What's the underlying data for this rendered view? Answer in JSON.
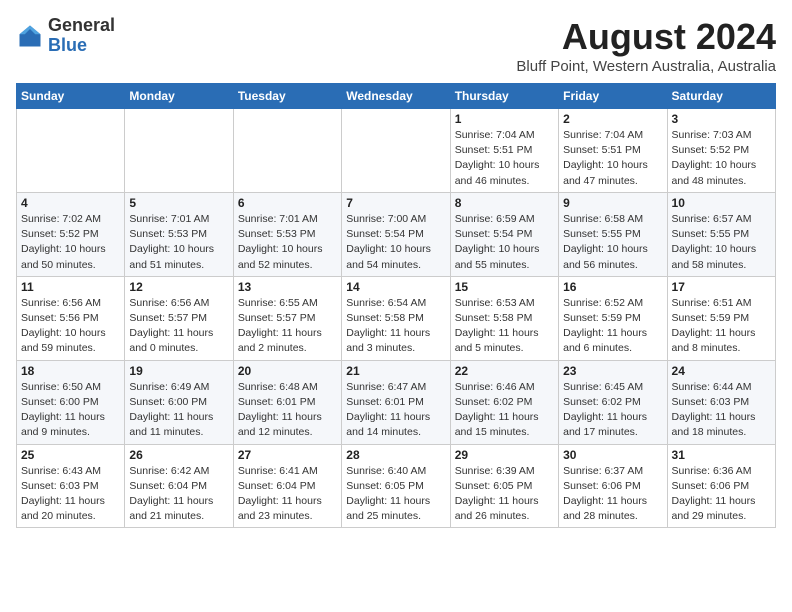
{
  "header": {
    "logo_general": "General",
    "logo_blue": "Blue",
    "month_title": "August 2024",
    "location": "Bluff Point, Western Australia, Australia"
  },
  "days_of_week": [
    "Sunday",
    "Monday",
    "Tuesday",
    "Wednesday",
    "Thursday",
    "Friday",
    "Saturday"
  ],
  "weeks": [
    [
      {
        "day": "",
        "detail": ""
      },
      {
        "day": "",
        "detail": ""
      },
      {
        "day": "",
        "detail": ""
      },
      {
        "day": "",
        "detail": ""
      },
      {
        "day": "1",
        "detail": "Sunrise: 7:04 AM\nSunset: 5:51 PM\nDaylight: 10 hours\nand 46 minutes."
      },
      {
        "day": "2",
        "detail": "Sunrise: 7:04 AM\nSunset: 5:51 PM\nDaylight: 10 hours\nand 47 minutes."
      },
      {
        "day": "3",
        "detail": "Sunrise: 7:03 AM\nSunset: 5:52 PM\nDaylight: 10 hours\nand 48 minutes."
      }
    ],
    [
      {
        "day": "4",
        "detail": "Sunrise: 7:02 AM\nSunset: 5:52 PM\nDaylight: 10 hours\nand 50 minutes."
      },
      {
        "day": "5",
        "detail": "Sunrise: 7:01 AM\nSunset: 5:53 PM\nDaylight: 10 hours\nand 51 minutes."
      },
      {
        "day": "6",
        "detail": "Sunrise: 7:01 AM\nSunset: 5:53 PM\nDaylight: 10 hours\nand 52 minutes."
      },
      {
        "day": "7",
        "detail": "Sunrise: 7:00 AM\nSunset: 5:54 PM\nDaylight: 10 hours\nand 54 minutes."
      },
      {
        "day": "8",
        "detail": "Sunrise: 6:59 AM\nSunset: 5:54 PM\nDaylight: 10 hours\nand 55 minutes."
      },
      {
        "day": "9",
        "detail": "Sunrise: 6:58 AM\nSunset: 5:55 PM\nDaylight: 10 hours\nand 56 minutes."
      },
      {
        "day": "10",
        "detail": "Sunrise: 6:57 AM\nSunset: 5:55 PM\nDaylight: 10 hours\nand 58 minutes."
      }
    ],
    [
      {
        "day": "11",
        "detail": "Sunrise: 6:56 AM\nSunset: 5:56 PM\nDaylight: 10 hours\nand 59 minutes."
      },
      {
        "day": "12",
        "detail": "Sunrise: 6:56 AM\nSunset: 5:57 PM\nDaylight: 11 hours\nand 0 minutes."
      },
      {
        "day": "13",
        "detail": "Sunrise: 6:55 AM\nSunset: 5:57 PM\nDaylight: 11 hours\nand 2 minutes."
      },
      {
        "day": "14",
        "detail": "Sunrise: 6:54 AM\nSunset: 5:58 PM\nDaylight: 11 hours\nand 3 minutes."
      },
      {
        "day": "15",
        "detail": "Sunrise: 6:53 AM\nSunset: 5:58 PM\nDaylight: 11 hours\nand 5 minutes."
      },
      {
        "day": "16",
        "detail": "Sunrise: 6:52 AM\nSunset: 5:59 PM\nDaylight: 11 hours\nand 6 minutes."
      },
      {
        "day": "17",
        "detail": "Sunrise: 6:51 AM\nSunset: 5:59 PM\nDaylight: 11 hours\nand 8 minutes."
      }
    ],
    [
      {
        "day": "18",
        "detail": "Sunrise: 6:50 AM\nSunset: 6:00 PM\nDaylight: 11 hours\nand 9 minutes."
      },
      {
        "day": "19",
        "detail": "Sunrise: 6:49 AM\nSunset: 6:00 PM\nDaylight: 11 hours\nand 11 minutes."
      },
      {
        "day": "20",
        "detail": "Sunrise: 6:48 AM\nSunset: 6:01 PM\nDaylight: 11 hours\nand 12 minutes."
      },
      {
        "day": "21",
        "detail": "Sunrise: 6:47 AM\nSunset: 6:01 PM\nDaylight: 11 hours\nand 14 minutes."
      },
      {
        "day": "22",
        "detail": "Sunrise: 6:46 AM\nSunset: 6:02 PM\nDaylight: 11 hours\nand 15 minutes."
      },
      {
        "day": "23",
        "detail": "Sunrise: 6:45 AM\nSunset: 6:02 PM\nDaylight: 11 hours\nand 17 minutes."
      },
      {
        "day": "24",
        "detail": "Sunrise: 6:44 AM\nSunset: 6:03 PM\nDaylight: 11 hours\nand 18 minutes."
      }
    ],
    [
      {
        "day": "25",
        "detail": "Sunrise: 6:43 AM\nSunset: 6:03 PM\nDaylight: 11 hours\nand 20 minutes."
      },
      {
        "day": "26",
        "detail": "Sunrise: 6:42 AM\nSunset: 6:04 PM\nDaylight: 11 hours\nand 21 minutes."
      },
      {
        "day": "27",
        "detail": "Sunrise: 6:41 AM\nSunset: 6:04 PM\nDaylight: 11 hours\nand 23 minutes."
      },
      {
        "day": "28",
        "detail": "Sunrise: 6:40 AM\nSunset: 6:05 PM\nDaylight: 11 hours\nand 25 minutes."
      },
      {
        "day": "29",
        "detail": "Sunrise: 6:39 AM\nSunset: 6:05 PM\nDaylight: 11 hours\nand 26 minutes."
      },
      {
        "day": "30",
        "detail": "Sunrise: 6:37 AM\nSunset: 6:06 PM\nDaylight: 11 hours\nand 28 minutes."
      },
      {
        "day": "31",
        "detail": "Sunrise: 6:36 AM\nSunset: 6:06 PM\nDaylight: 11 hours\nand 29 minutes."
      }
    ]
  ]
}
